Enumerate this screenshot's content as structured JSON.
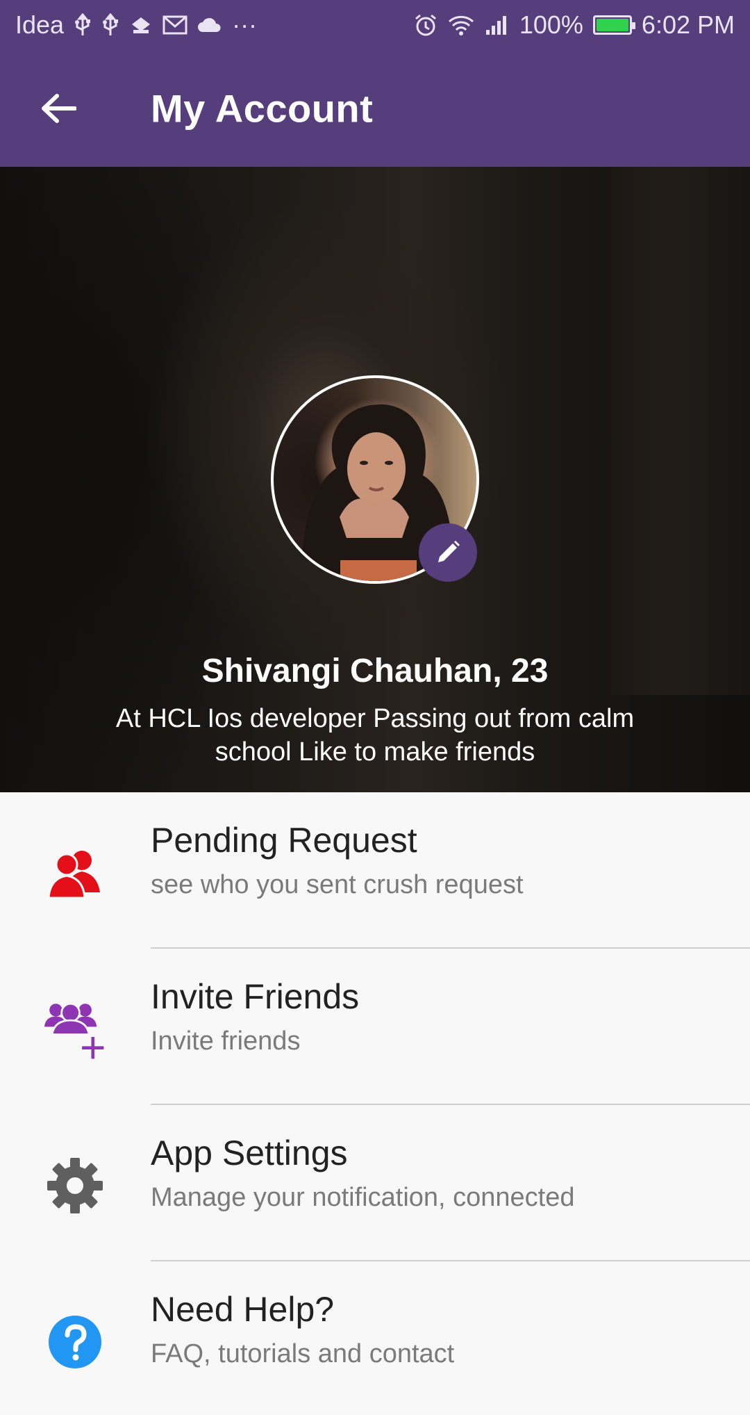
{
  "status_bar": {
    "carrier": "Idea",
    "overflow": "···",
    "battery_percent": "100%",
    "battery_level": 1.0,
    "time": "6:02 PM",
    "icons": [
      "usb-icon",
      "usb-icon",
      "debug-icon",
      "gmail-icon",
      "cloud-icon",
      "alarm-icon",
      "wifi-icon",
      "signal-icon",
      "battery-icon"
    ]
  },
  "app_bar": {
    "title": "My Account",
    "back_icon": "arrow-left-icon"
  },
  "profile": {
    "name": "Shivangi Chauhan, 23",
    "bio": "At HCL Ios developer Passing out from calm school Like to make friends",
    "edit_icon": "pencil-icon"
  },
  "menu": [
    {
      "title": "Pending Request",
      "subtitle": "see who you sent crush request",
      "icon": "people-icon",
      "color": "#e3101a"
    },
    {
      "title": "Invite Friends",
      "subtitle": "Invite friends",
      "icon": "add-group-icon",
      "color": "#8e35b4"
    },
    {
      "title": "App Settings",
      "subtitle": "Manage your notification, connected",
      "icon": "gear-icon",
      "color": "#5f5f5f"
    },
    {
      "title": "Need Help?",
      "subtitle": "FAQ, tutorials and contact",
      "icon": "help-icon",
      "color": "#2196f3"
    }
  ],
  "colors": {
    "primary": "#563d7c",
    "battery": "#2fd24b"
  }
}
